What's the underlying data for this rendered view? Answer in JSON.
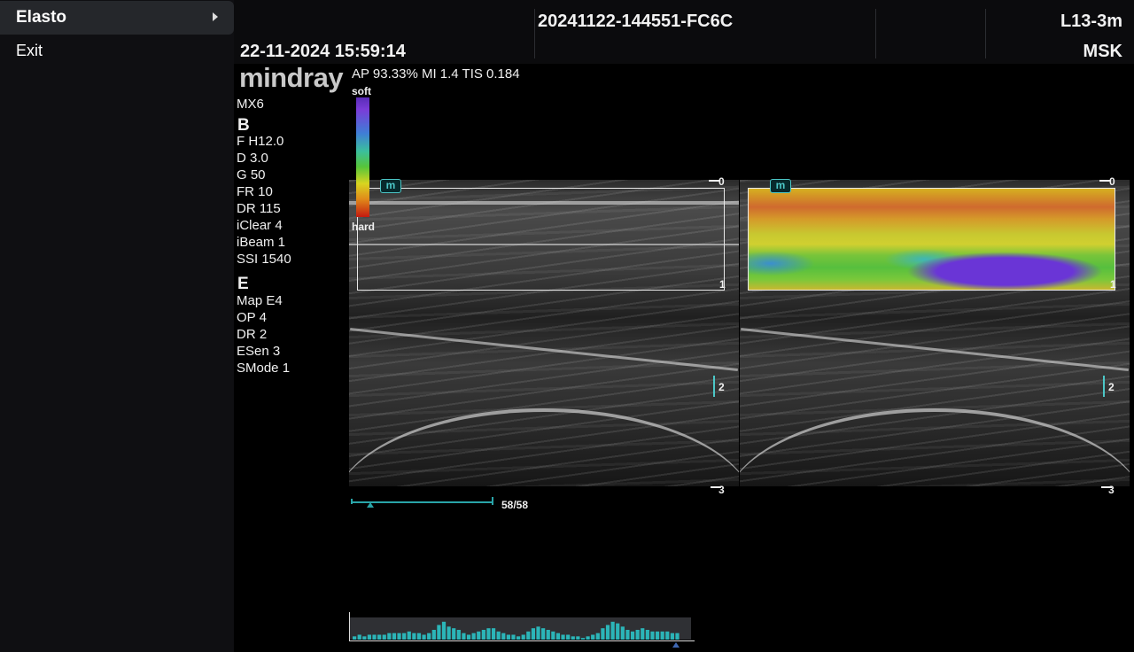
{
  "menu": {
    "selected_label": "Elasto",
    "exit_label": "Exit"
  },
  "header": {
    "exam_id": "20241122-144551-FC6C",
    "datetime": "22-11-2024 15:59:14",
    "probe": "L13-3m",
    "preset": "MSK"
  },
  "brand": {
    "logo": "mindray",
    "model": "MX6"
  },
  "info_line": "AP 93.33%   MI 1.4  TIS 0.184",
  "b_params": {
    "heading": "B",
    "items": [
      "F H12.0",
      "D 3.0",
      "G 50",
      "FR 10",
      "DR 115",
      "iClear 4",
      "iBeam 1",
      "SSI 1540"
    ]
  },
  "e_params": {
    "heading": "E",
    "items": [
      "Map E4",
      "OP 4",
      "DR 2",
      "ESen 3",
      "SMode 1"
    ]
  },
  "colorbar": {
    "top_label": "soft",
    "bottom_label": "hard"
  },
  "badge": "m",
  "depth_marks": [
    "0",
    "1",
    "2",
    "3"
  ],
  "cine": {
    "frames": "58/58",
    "fraction": 1.0
  },
  "histogram": [
    2,
    3,
    2,
    3,
    3,
    3,
    3,
    4,
    4,
    4,
    4,
    5,
    4,
    4,
    3,
    4,
    6,
    9,
    11,
    8,
    7,
    6,
    4,
    3,
    4,
    5,
    6,
    7,
    7,
    5,
    4,
    3,
    3,
    2,
    3,
    5,
    7,
    8,
    7,
    6,
    5,
    4,
    3,
    3,
    2,
    2,
    1,
    2,
    3,
    4,
    7,
    9,
    11,
    10,
    8,
    6,
    5,
    6,
    7,
    6,
    5,
    5,
    5,
    5,
    4,
    4
  ]
}
